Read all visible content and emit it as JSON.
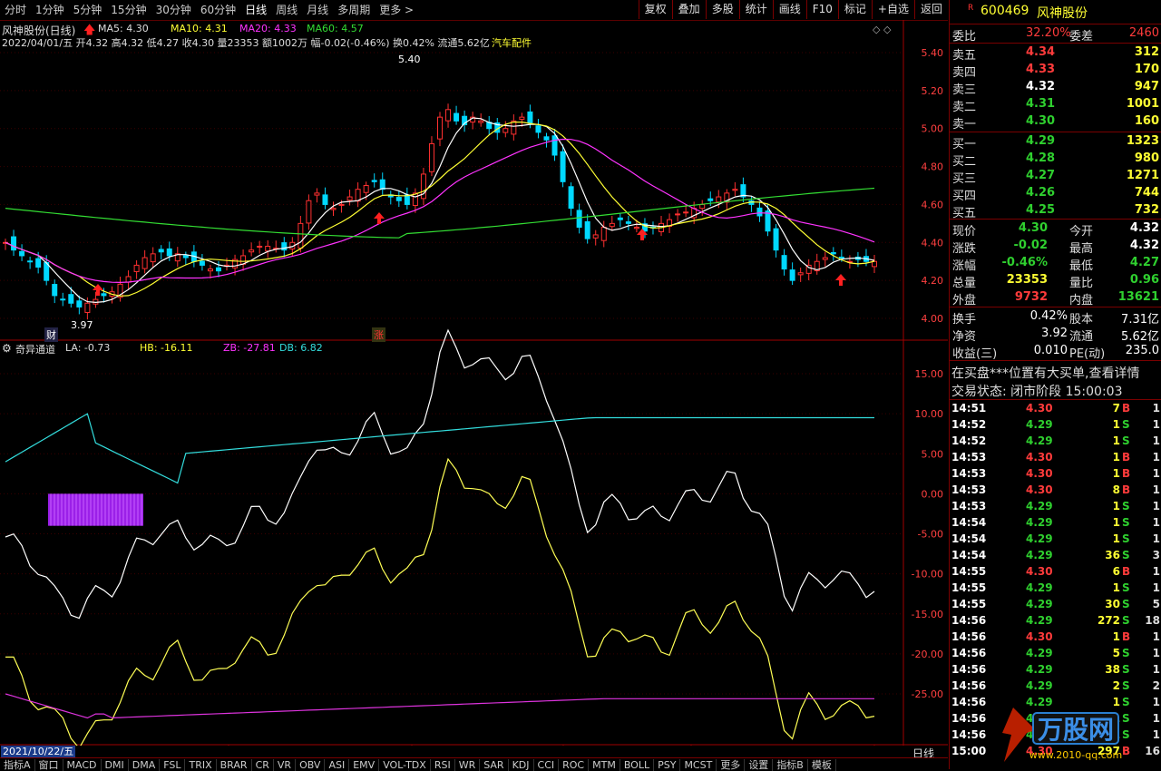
{
  "toolbar": {
    "periods": [
      "分时",
      "1分钟",
      "5分钟",
      "15分钟",
      "30分钟",
      "60分钟",
      "日线",
      "周线",
      "月线",
      "多周期",
      "更多 >"
    ],
    "selected": "日线",
    "actions": [
      "复权",
      "叠加",
      "多股",
      "统计",
      "画线",
      "F10",
      "标记",
      "+自选",
      "返回"
    ]
  },
  "chart_header": {
    "title": "风神股份(日线)",
    "ma5": "MA5: 4.30",
    "ma10": "MA10: 4.31",
    "ma20": "MA20: 4.33",
    "ma60": "MA60: 4.57",
    "info": "2022/04/01/五 开4.32 高4.32 低4.27 收4.30 量23353 额1002万 幅-0.02(-0.46%) 换0.42% 流通5.62亿",
    "sector": "汽车配件",
    "high_label": "5.40",
    "low_label": "3.97",
    "cai": "财",
    "zhang": "涨"
  },
  "price_axis": [
    "5.40",
    "5.20",
    "5.00",
    "4.80",
    "4.60",
    "4.40",
    "4.20",
    "4.00"
  ],
  "indicator": {
    "name": "奇异通道",
    "la": "LA: -0.73",
    "hb": "HB: -16.11",
    "zb": "ZB: -27.81",
    "db": "DB: 6.82",
    "axis": [
      "15.00",
      "10.00",
      "5.00",
      "0.00",
      "-5.00",
      "-10.00",
      "-15.00",
      "-20.00",
      "-25.00"
    ]
  },
  "date_axis": {
    "start": "2021/10/22/五",
    "labels": [
      "12",
      "1",
      "2",
      "3",
      "4"
    ],
    "period": "日线"
  },
  "bottom_tabs": [
    "指标A",
    "窗口",
    "MACD",
    "DMI",
    "DMA",
    "FSL",
    "TRIX",
    "BRAR",
    "CR",
    "VR",
    "OBV",
    "ASI",
    "EMV",
    "VOL-TDX",
    "RSI",
    "WR",
    "SAR",
    "KDJ",
    "CCI",
    "ROC",
    "MTM",
    "BOLL",
    "PSY",
    "MCST",
    "更多",
    "设置",
    "指标B",
    "模板"
  ],
  "quote": {
    "code": "600469",
    "name": "风神股份",
    "weibi_label": "委比",
    "weibi": "32.20%",
    "weicha_label": "委差",
    "weicha": "2460",
    "asks": [
      {
        "label": "卖五",
        "price": "4.34",
        "vol": "312",
        "color": "#ff3b3b"
      },
      {
        "label": "卖四",
        "price": "4.33",
        "vol": "170",
        "color": "#ff3b3b"
      },
      {
        "label": "卖三",
        "price": "4.32",
        "vol": "947",
        "color": "#ffffff"
      },
      {
        "label": "卖二",
        "price": "4.31",
        "vol": "1001",
        "color": "#2fd02f"
      },
      {
        "label": "卖一",
        "price": "4.30",
        "vol": "160",
        "color": "#2fd02f"
      }
    ],
    "bids": [
      {
        "label": "买一",
        "price": "4.29",
        "vol": "1323",
        "color": "#2fd02f"
      },
      {
        "label": "买二",
        "price": "4.28",
        "vol": "980",
        "color": "#2fd02f"
      },
      {
        "label": "买三",
        "price": "4.27",
        "vol": "1271",
        "color": "#2fd02f"
      },
      {
        "label": "买四",
        "price": "4.26",
        "vol": "744",
        "color": "#2fd02f"
      },
      {
        "label": "买五",
        "price": "4.25",
        "vol": "732",
        "color": "#2fd02f"
      }
    ],
    "stats": [
      {
        "l1": "现价",
        "v1": "4.30",
        "c1": "#2fd02f",
        "l2": "今开",
        "v2": "4.32",
        "c2": "#ffffff"
      },
      {
        "l1": "涨跌",
        "v1": "-0.02",
        "c1": "#2fd02f",
        "l2": "最高",
        "v2": "4.32",
        "c2": "#ffffff"
      },
      {
        "l1": "涨幅",
        "v1": "-0.46%",
        "c1": "#2fd02f",
        "l2": "最低",
        "v2": "4.27",
        "c2": "#2fd02f"
      },
      {
        "l1": "总量",
        "v1": "23353",
        "c1": "#ffff33",
        "l2": "量比",
        "v2": "0.96",
        "c2": "#2fd02f"
      },
      {
        "l1": "外盘",
        "v1": "9732",
        "c1": "#ff3b3b",
        "l2": "内盘",
        "v2": "13621",
        "c2": "#2fd02f"
      }
    ],
    "stats2": [
      {
        "l1": "换手",
        "v1": "0.42%",
        "l2": "股本",
        "v2": "7.31亿"
      },
      {
        "l1": "净资",
        "v1": "3.92",
        "l2": "流通",
        "v2": "5.62亿"
      },
      {
        "l1": "收益(三)",
        "v1": "0.010",
        "l2": "PE(动)",
        "v2": "235.0"
      }
    ],
    "notice": "在买盘***位置有大买单,查看详情",
    "status": "交易状态: 闭市阶段 15:00:03",
    "ticks": [
      [
        "14:51",
        "4.30",
        "7",
        "B",
        "1"
      ],
      [
        "14:52",
        "4.29",
        "1",
        "S",
        "1"
      ],
      [
        "14:52",
        "4.29",
        "1",
        "S",
        "1"
      ],
      [
        "14:53",
        "4.30",
        "1",
        "B",
        "1"
      ],
      [
        "14:53",
        "4.30",
        "1",
        "B",
        "1"
      ],
      [
        "14:53",
        "4.30",
        "8",
        "B",
        "1"
      ],
      [
        "14:53",
        "4.29",
        "1",
        "S",
        "1"
      ],
      [
        "14:54",
        "4.29",
        "1",
        "S",
        "1"
      ],
      [
        "14:54",
        "4.29",
        "1",
        "S",
        "1"
      ],
      [
        "14:54",
        "4.29",
        "36",
        "S",
        "3"
      ],
      [
        "14:55",
        "4.30",
        "6",
        "B",
        "1"
      ],
      [
        "14:55",
        "4.29",
        "1",
        "S",
        "1"
      ],
      [
        "14:55",
        "4.29",
        "30",
        "S",
        "5"
      ],
      [
        "14:56",
        "4.29",
        "272",
        "S",
        "18"
      ],
      [
        "14:56",
        "4.30",
        "1",
        "B",
        "1"
      ],
      [
        "14:56",
        "4.29",
        "5",
        "S",
        "1"
      ],
      [
        "14:56",
        "4.29",
        "38",
        "S",
        "1"
      ],
      [
        "14:56",
        "4.29",
        "2",
        "S",
        "2"
      ],
      [
        "14:56",
        "4.29",
        "1",
        "S",
        "1"
      ],
      [
        "14:56",
        "4.29",
        "1",
        "S",
        "1"
      ],
      [
        "14:56",
        "4.29",
        "1",
        "S",
        "1"
      ],
      [
        "15:00",
        "4.30",
        "297",
        "B",
        "16"
      ]
    ]
  },
  "watermark": "万股网"
}
